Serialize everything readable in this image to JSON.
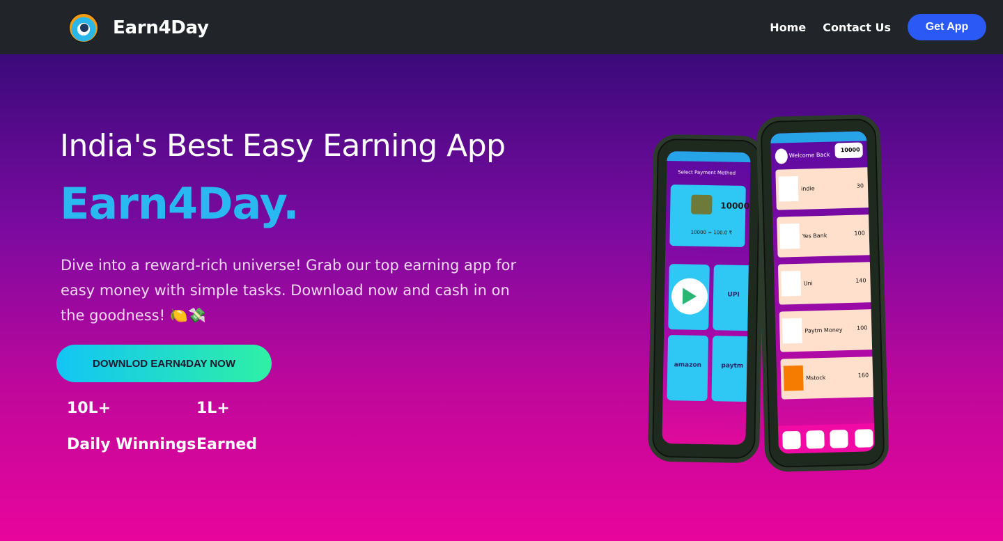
{
  "nav": {
    "brand": "Earn4Day",
    "links": [
      "Home",
      "Contact Us"
    ],
    "get_app": "Get App"
  },
  "hero": {
    "headline": "India's Best Easy Earning App",
    "brand_big": "Earn4Day.",
    "description": "Dive into a reward-rich universe! Grab our top earning app for easy money with simple tasks. Download now and cash in on the goodness! 🍋💸",
    "cta": "DOWNLOD EARN4DAY NOW",
    "stats": [
      {
        "value": "10L+",
        "label": "Daily Winnings"
      },
      {
        "value": "1L+",
        "label": "Earned"
      }
    ]
  },
  "phone_left": {
    "title": "Select Payment Method",
    "wallet_amount": "10000",
    "rate": "10000 = 100.0 ₹",
    "tiles": [
      "",
      "UPI",
      "amazon",
      "paytm"
    ]
  },
  "phone_right": {
    "welcome": "Welcome Back",
    "coins": "10000",
    "offers": [
      {
        "name": "indie",
        "points": "30"
      },
      {
        "name": "Yes Bank",
        "points": "100"
      },
      {
        "name": "Uni",
        "points": "140"
      },
      {
        "name": "Paytm Money",
        "points": "100"
      },
      {
        "name": "Mstock",
        "points": "160"
      }
    ]
  },
  "colors": {
    "navbar": "#212529",
    "accent_button": "#2a59f5",
    "brand_text": "#2ab8f0"
  }
}
